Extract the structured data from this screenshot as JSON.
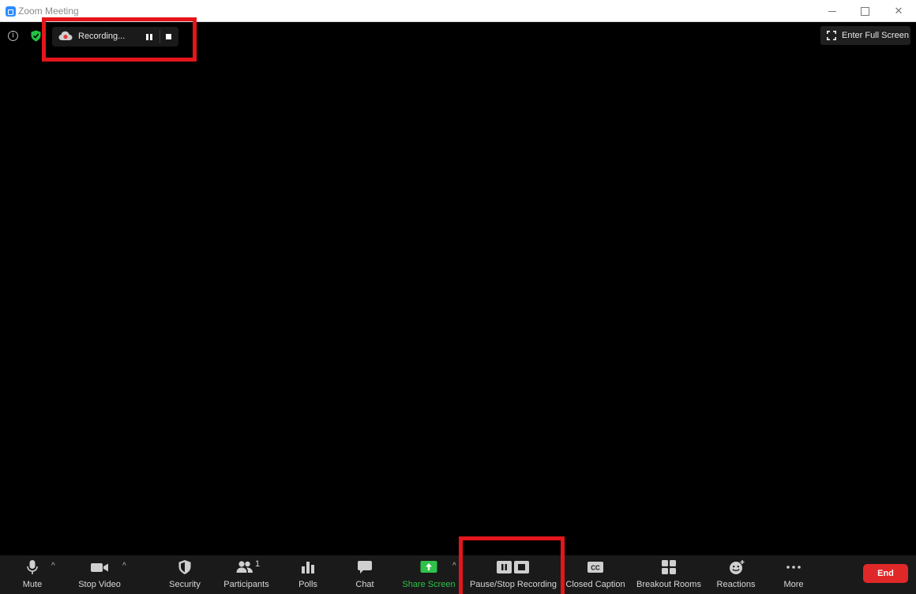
{
  "window": {
    "title": "Zoom Meeting"
  },
  "recording_indicator": {
    "label": "Recording..."
  },
  "fullscreen": {
    "label": "Enter Full Screen"
  },
  "toolbar": {
    "mute": "Mute",
    "stop_video": "Stop Video",
    "security": "Security",
    "participants": "Participants",
    "participants_count": "1",
    "polls": "Polls",
    "chat": "Chat",
    "share_screen": "Share Screen",
    "pause_stop_recording": "Pause/Stop Recording",
    "closed_caption": "Closed Caption",
    "breakout_rooms": "Breakout Rooms",
    "reactions": "Reactions",
    "more": "More",
    "end": "End"
  },
  "colors": {
    "accent_green": "#2ec24a",
    "end_red": "#e02828",
    "highlight_red": "#e4161b",
    "zoom_blue": "#2d8cff"
  }
}
